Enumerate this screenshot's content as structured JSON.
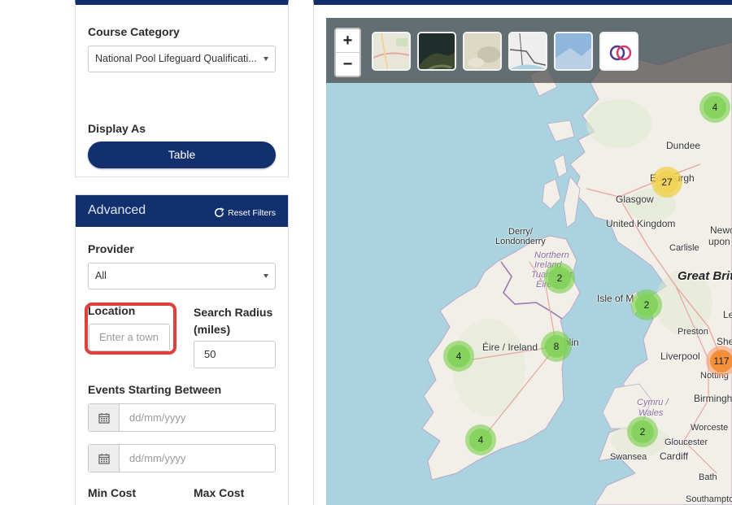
{
  "filters": {
    "course_category": {
      "label": "Course Category",
      "selected": "National Pool Lifeguard Qualificati..."
    },
    "display_as": {
      "label": "Display As",
      "button": "Table"
    },
    "advanced": {
      "title": "Advanced",
      "reset_label": "Reset Filters",
      "provider": {
        "label": "Provider",
        "selected": "All"
      },
      "location": {
        "label": "Location",
        "placeholder": "Enter a town"
      },
      "search_radius": {
        "label": "Search Radius (miles)",
        "value": "50"
      },
      "events_between": {
        "label": "Events Starting Between",
        "start_placeholder": "dd/mm/yyyy",
        "end_placeholder": "dd/mm/yyyy"
      },
      "min_cost_label": "Min Cost",
      "max_cost_label": "Max Cost"
    }
  },
  "map": {
    "zoom_in": "+",
    "zoom_out": "−",
    "layers": [
      "street-map",
      "satellite",
      "terrain",
      "transport",
      "relief",
      "logo-layer"
    ],
    "clusters": [
      {
        "count": "4",
        "color": "green"
      },
      {
        "count": "27",
        "color": "yellow"
      },
      {
        "count": "2",
        "color": "green"
      },
      {
        "count": "2",
        "color": "green"
      },
      {
        "count": "4",
        "color": "green"
      },
      {
        "count": "8",
        "color": "green"
      },
      {
        "count": "117",
        "color": "orange"
      },
      {
        "count": "4",
        "color": "green"
      },
      {
        "count": "2",
        "color": "green"
      }
    ],
    "place_labels": {
      "dundee": "Dundee",
      "edinburgh": "Edinburgh",
      "glasgow": "Glasgow",
      "uk": "United Kingdom",
      "newcastle": "Newc",
      "upon": "upon",
      "carlisle": "Carlisle",
      "derry": "Derry/",
      "londonderry": "Londonderry",
      "ni1": "Northern",
      "ni2": "Ireland",
      "ni3": "Tuaisceart",
      "ni4": "Éireann",
      "great_britain": "Great Brit",
      "isle_of_man": "Isle of M",
      "preston": "Preston",
      "leeds": "Le",
      "sheffield": "She",
      "eire": "Éire / Ireland",
      "dublin": "blin",
      "liverpool": "Liverpool",
      "nottingham": "Notting",
      "birmingham": "Birmingh",
      "cymru": "Cymru /",
      "wales": "Wales",
      "worcester": "Worceste",
      "gloucester": "Gloucester",
      "swansea": "Swansea",
      "cardiff": "Cardiff",
      "bath": "Bath",
      "southampton": "Southampto"
    }
  },
  "colors": {
    "brand_navy": "#12306e",
    "highlight_red": "#e0403b",
    "sea": "#aad3df",
    "land": "#f2efe9"
  }
}
